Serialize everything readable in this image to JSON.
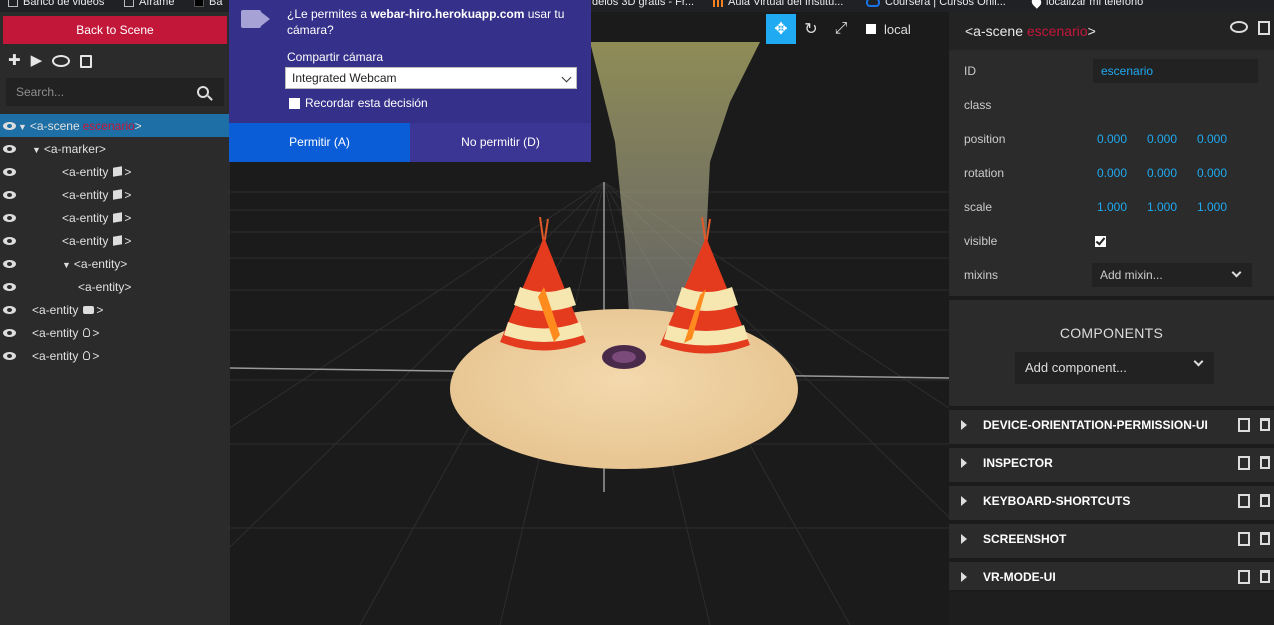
{
  "bookmarks": [
    {
      "label": "Banco de videos",
      "icon": "folder-icon"
    },
    {
      "label": "Aframe",
      "icon": "folder-icon"
    },
    {
      "label": "Ba",
      "icon": "app-icon"
    },
    {
      "label": "delos 3D gratis - Fr...",
      "icon": ""
    },
    {
      "label": "Aula Virtual del Institu...",
      "icon": "moodle-icon"
    },
    {
      "label": "Coursera | Cursos Onli...",
      "icon": "coursera-icon"
    },
    {
      "label": "localizar mi teléfono",
      "icon": "pin-icon"
    }
  ],
  "left_panel": {
    "back_label": "Back to Scene",
    "search_placeholder": "Search...",
    "tree": [
      {
        "tag": "<a-scene",
        "id": "escenario",
        "end": ">",
        "indent": 0,
        "caret": "▼"
      },
      {
        "tag": "<a-marker>",
        "indent": 1,
        "caret": "▼"
      },
      {
        "tag": "<a-entity",
        "end": ">",
        "indent": 2,
        "icon": "box"
      },
      {
        "tag": "<a-entity",
        "end": ">",
        "indent": 2,
        "icon": "box"
      },
      {
        "tag": "<a-entity",
        "end": ">",
        "indent": 2,
        "icon": "box"
      },
      {
        "tag": "<a-entity",
        "end": ">",
        "indent": 2,
        "icon": "box"
      },
      {
        "tag": "<a-entity>",
        "indent": 2,
        "caret": "▼"
      },
      {
        "tag": "<a-entity>",
        "indent": 3
      },
      {
        "tag": "<a-entity",
        "end": ">",
        "indent": 1,
        "icon": "camera"
      },
      {
        "tag": "<a-entity",
        "end": ">",
        "indent": 1,
        "icon": "light"
      },
      {
        "tag": "<a-entity",
        "end": ">",
        "indent": 1,
        "icon": "light"
      }
    ]
  },
  "viewport": {
    "local_label": "local"
  },
  "permission": {
    "question_prefix": "¿Le permites a ",
    "site": "webar-hiro.herokuapp.com",
    "question_suffix": " usar tu cámara?",
    "camera_label": "Compartir cámara",
    "camera_value": "Integrated Webcam",
    "remember_label": "Recordar esta decisión",
    "allow_label": "Permitir (A)",
    "deny_label": "No permitir (D)"
  },
  "right_panel": {
    "title_tag": "<a-scene",
    "title_id": "escenario",
    "title_end": ">",
    "id_label": "ID",
    "id_value": "escenario",
    "class_label": "class",
    "position_label": "position",
    "position": [
      "0.000",
      "0.000",
      "0.000"
    ],
    "rotation_label": "rotation",
    "rotation": [
      "0.000",
      "0.000",
      "0.000"
    ],
    "scale_label": "scale",
    "scale": [
      "1.000",
      "1.000",
      "1.000"
    ],
    "visible_label": "visible",
    "mixins_label": "mixins",
    "mixins_placeholder": "Add mixin...",
    "components_title": "COMPONENTS",
    "add_component": "Add component...",
    "components": [
      "DEVICE-ORIENTATION-PERMISSION-UI",
      "INSPECTOR",
      "KEYBOARD-SHORTCUTS",
      "SCREENSHOT",
      "VR-MODE-UI"
    ]
  },
  "colors": {
    "accent_red": "#c3173a",
    "accent_blue": "#1faaf1",
    "dialog_purple": "#35308a",
    "allow_blue": "#0b5cd7"
  }
}
